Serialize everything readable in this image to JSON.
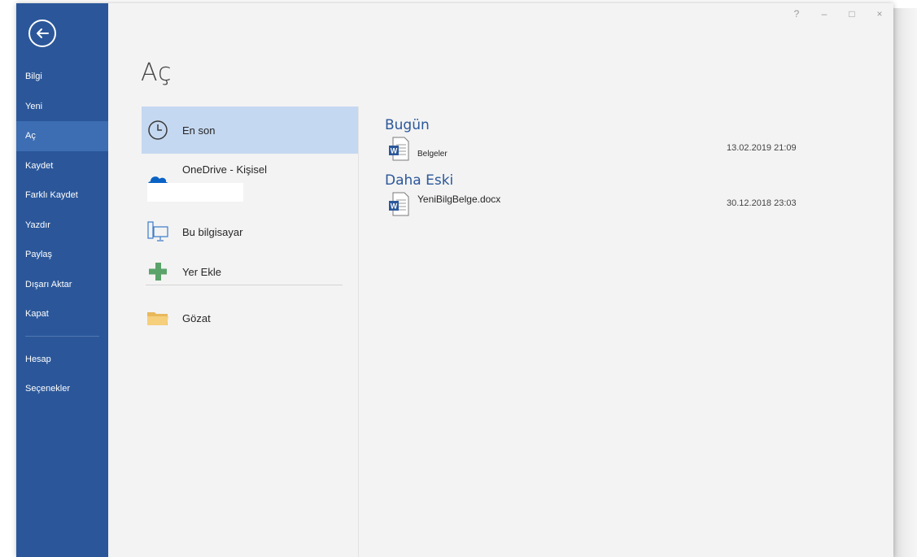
{
  "nav": {
    "items": [
      {
        "label": "Bilgi",
        "active": false
      },
      {
        "label": "Yeni",
        "active": false
      },
      {
        "label": "Aç",
        "active": true
      },
      {
        "label": "Kaydet",
        "active": false
      },
      {
        "label": "Farklı Kaydet",
        "active": false
      },
      {
        "label": "Yazdır",
        "active": false
      },
      {
        "label": "Paylaş",
        "active": false
      },
      {
        "label": "Dışarı Aktar",
        "active": false
      },
      {
        "label": "Kapat",
        "active": false
      }
    ],
    "bottom_items": [
      {
        "label": "Hesap"
      },
      {
        "label": "Seçenekler"
      }
    ]
  },
  "window_controls": {
    "help": "?",
    "minimize": "–",
    "maximize": "□",
    "close": "×"
  },
  "page": {
    "title": "Aç"
  },
  "places": [
    {
      "label": "En son",
      "icon": "clock-icon",
      "active": true
    },
    {
      "label": "OneDrive - Kişisel",
      "icon": "cloud-icon",
      "active": false
    },
    {
      "label": "Bu bilgisayar",
      "icon": "computer-icon",
      "active": false
    },
    {
      "label": "Yer Ekle",
      "icon": "plus-icon",
      "active": false
    },
    {
      "label": "Gözat",
      "icon": "folder-icon",
      "active": false
    }
  ],
  "recent": {
    "groups": [
      {
        "title": "Bugün",
        "docs": [
          {
            "name": "Belgeler",
            "date": "13.02.2019 21:09",
            "icon": "word-doc-icon"
          }
        ]
      },
      {
        "title": "Daha Eski",
        "docs": [
          {
            "name": "YeniBilgBelge.docx",
            "date": "30.12.2018 23:03",
            "icon": "word-doc-icon"
          }
        ]
      }
    ]
  },
  "colors": {
    "nav_bg": "#2b579a",
    "nav_active": "#3d6db2",
    "place_active": "#c5d8f1",
    "accent_text": "#2b579a",
    "content_bg": "#f3f3f3"
  }
}
